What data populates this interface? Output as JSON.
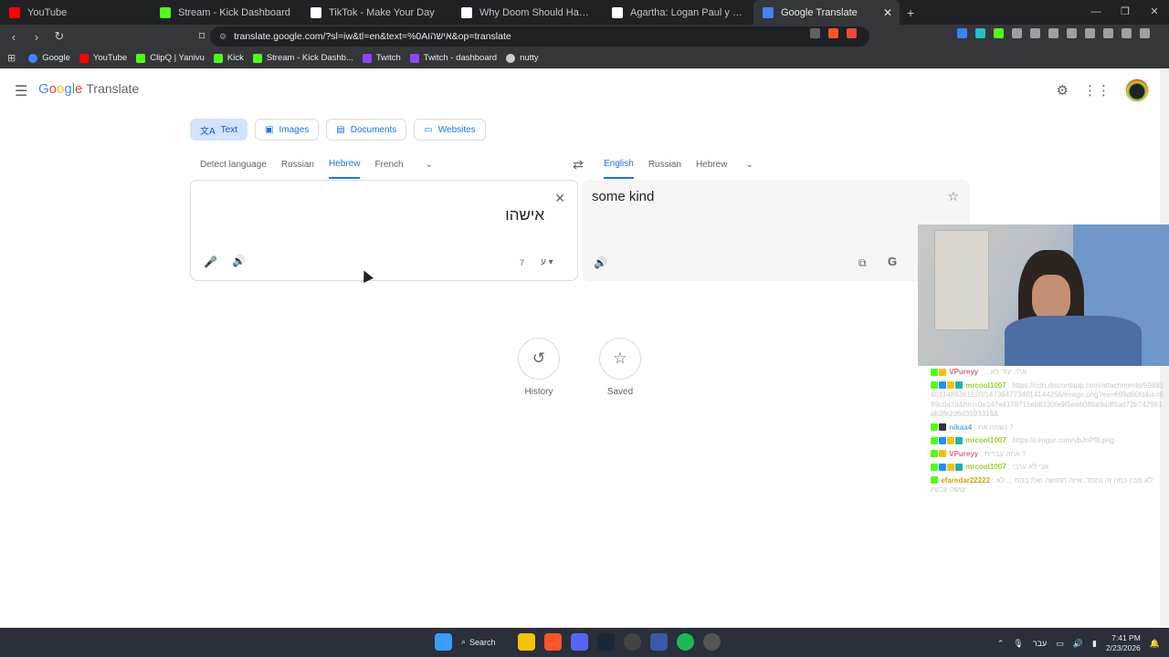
{
  "browser": {
    "tabs": [
      {
        "title": "YouTube",
        "fav_color": "#ff0000"
      },
      {
        "title": "Stream - Kick Dashboard",
        "fav_color": "#53fc18"
      },
      {
        "title": "TikTok - Make Your Day",
        "fav_color": "#ffffff"
      },
      {
        "title": "Why Doom Should Have Won in Ove",
        "fav_color": "#ffffff"
      },
      {
        "title": "Agartha: Logan Paul y Calvin Harris a",
        "fav_color": "#ffffff"
      },
      {
        "title": "Google Translate",
        "fav_color": "#4285f4"
      }
    ],
    "url": "translate.google.com/?sl=iw&tl=en&text=%0Aאישהו&op=translate",
    "bookmarks": [
      {
        "label": "Google",
        "color": "#4285f4"
      },
      {
        "label": "YouTube",
        "color": "#ff0000"
      },
      {
        "label": "ClipQ | Yanivu",
        "color": "#53fc18"
      },
      {
        "label": "Kick",
        "color": "#53fc18"
      },
      {
        "label": "Stream - Kick Dashb...",
        "color": "#53fc18"
      },
      {
        "label": "Twitch",
        "color": "#9146ff"
      },
      {
        "label": "Twitch - dashboard",
        "color": "#9146ff"
      },
      {
        "label": "nutty",
        "color": "#cccccc"
      }
    ]
  },
  "translate": {
    "logo_google": "Google",
    "logo_product": "Translate",
    "mode_tabs": [
      "Text",
      "Images",
      "Documents",
      "Websites"
    ],
    "source_langs": [
      "Detect language",
      "Russian",
      "Hebrew",
      "French"
    ],
    "target_langs": [
      "English",
      "Russian",
      "Hebrew"
    ],
    "source_text": "אישהו",
    "char_count": "7",
    "target_text": "some kind",
    "history_label": "History",
    "saved_label": "Saved"
  },
  "chat": [
    {
      "user": "VPureyy",
      "user_color": "#d46b8c",
      "text": ": ...אחי, עוד לא"
    },
    {
      "user": "mrcool1007",
      "user_color": "#9acd32",
      "text": ": https://cdn.discordapp.com/attachments/998814011489361920/1473647734014144256/image.png?ex=699d60fd&is=699c0a7d&hm=0e147e4178711eb8230fe9f5ea6088a94df6ad72b742961ab3fe2d6d3593316&"
    },
    {
      "user": "nikaa4",
      "user_color": "#6fa8dc",
      "text": ": נשמה את ?"
    },
    {
      "user": "mrcool1007",
      "user_color": "#9acd32",
      "text": ": https://i.imgur.com/vbJnPf8.png"
    },
    {
      "user": "VPureyy",
      "user_color": "#d46b8c",
      "text": ": אתה עברית ?"
    },
    {
      "user": "mrcool1007",
      "user_color": "#9acd32",
      "text": ": אני לא ערבי"
    },
    {
      "user": "efaredar22222",
      "user_color": "#d4a017",
      "text": ": לא מבין כמה זה נחמד, איזה תחושה זאת בטח ... לא עושה עכשיו"
    }
  ],
  "taskbar": {
    "search_label": "Search",
    "lang": "עבר",
    "time": "7:41 PM",
    "date": "2/23/2026"
  }
}
